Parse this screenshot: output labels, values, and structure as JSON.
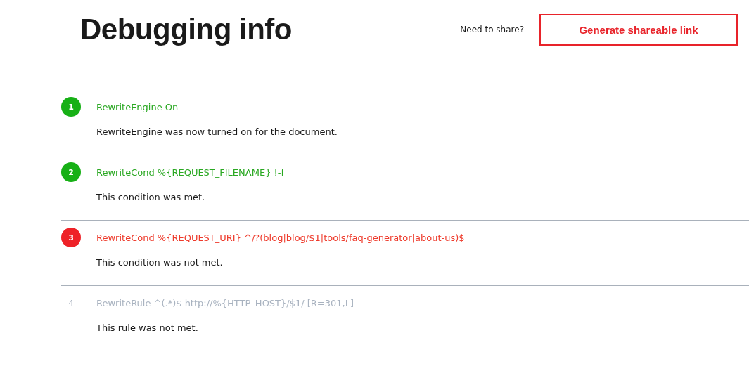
{
  "title": "Debugging info",
  "share": {
    "prompt": "Need to share?",
    "button": "Generate shareable link"
  },
  "steps": [
    {
      "number": "1",
      "kind": "met",
      "rule": "RewriteEngine On",
      "message": "RewriteEngine was now turned on for the document."
    },
    {
      "number": "2",
      "kind": "met",
      "rule": "RewriteCond %{REQUEST_FILENAME} !-f",
      "message": "This condition was met."
    },
    {
      "number": "3",
      "kind": "failed",
      "rule": "RewriteCond %{REQUEST_URI} ^/?(blog|blog/$1|tools/faq-generator|about-us)$",
      "message": "This condition was not met."
    },
    {
      "number": "4",
      "kind": "skipped",
      "rule": "RewriteRule ^(.*)$ http://%{HTTP_HOST}/$1/ [R=301,L]",
      "message": "This rule was not met."
    }
  ]
}
